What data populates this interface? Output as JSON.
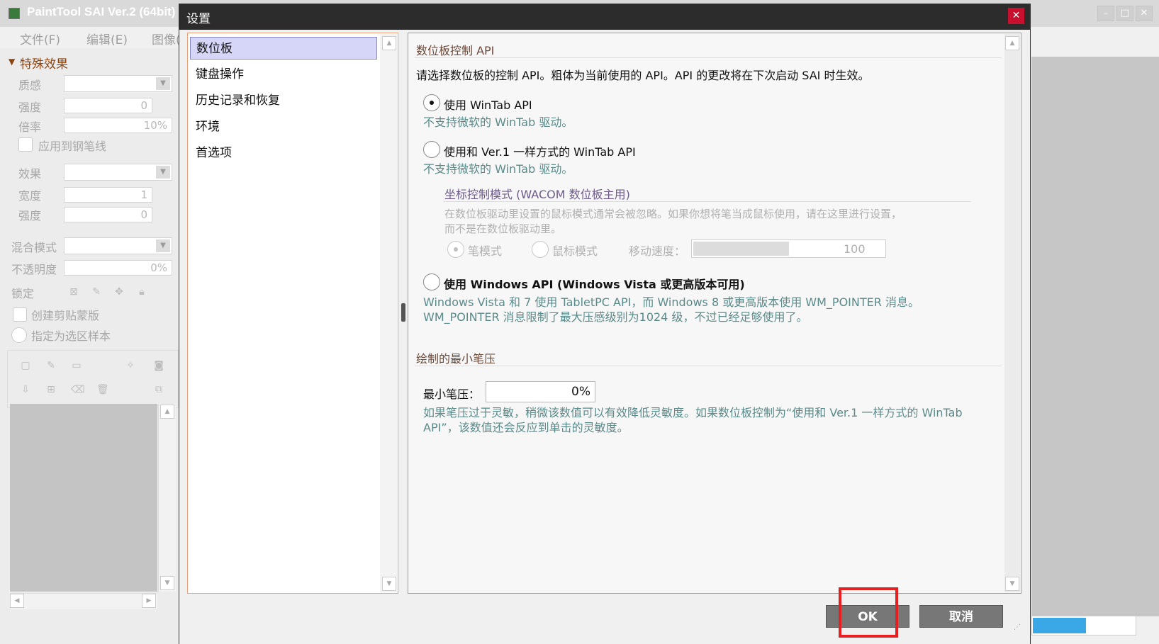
{
  "background_app": {
    "title": "PaintTool SAI Ver.2 (64bit)",
    "menu": [
      "文件(F)",
      "编辑(E)",
      "图像("
    ],
    "left_panel": {
      "section_title": "特殊效果",
      "texture_label": "质感",
      "strength_label": "强度",
      "strength_value": "0",
      "scale_label": "倍率",
      "scale_value": "10%",
      "apply_pen_label": "应用到钢笔线",
      "effect_label": "效果",
      "width_label": "宽度",
      "width_value": "1",
      "strength2_label": "强度",
      "strength2_value": "0",
      "blend_mode_label": "混合模式",
      "opacity_label": "不透明度",
      "opacity_value": "0%",
      "lock_label": "锁定",
      "clip_label": "创建剪贴蒙版",
      "selection_sample_label": "指定为选区样本"
    }
  },
  "dialog": {
    "title": "设置",
    "nav_items": [
      "数位板",
      "键盘操作",
      "历史记录和恢复",
      "环境",
      "首选项"
    ],
    "selected_nav": "数位板",
    "tablet_api": {
      "section_title": "数位板控制 API",
      "description": "请选择数位板的控制 API。粗体为当前使用的 API。API 的更改将在下次启动 SAI 时生效。",
      "options": [
        {
          "label": "使用 WinTab API",
          "note": "不支持微软的 WinTab 驱动。",
          "checked": true,
          "bold": false
        },
        {
          "label": "使用和 Ver.1 一样方式的 WinTab API",
          "note": "不支持微软的 WinTab 驱动。",
          "checked": false,
          "bold": false
        },
        {
          "label": "使用 Windows API (Windows Vista 或更高版本可用)",
          "note_lines": [
            "Windows Vista 和 7 使用 TabletPC API，而 Windows 8 或更高版本使用 WM_POINTER 消息。",
            "WM_POINTER 消息限制了最大压感级别为1024 级，不过已经足够使用了。"
          ],
          "checked": false,
          "bold": true
        }
      ],
      "coord_mode": {
        "title": "坐标控制模式 (WACOM 数位板主用)",
        "desc_lines": [
          "在数位板驱动里设置的鼠标模式通常会被忽略。如果你想将笔当成鼠标使用，请在这里进行设置，",
          "而不是在数位板驱动里。"
        ],
        "pen_mode": "笔模式",
        "mouse_mode": "鼠标模式",
        "speed_label": "移动速度：",
        "speed_value": "100",
        "speed_fraction": 0.5
      }
    },
    "min_pressure": {
      "section_title": "绘制的最小笔压",
      "label": "最小笔压：",
      "value": "0%",
      "hint_lines": [
        "如果笔压过于灵敏，稍微该数值可以有效降低灵敏度。如果数位板控制为“使用和 Ver.1 一样方式的 WinTab",
        "API”，该数值还会反应到单击的灵敏度。"
      ]
    },
    "ok_label": "OK",
    "cancel_label": "取消"
  },
  "colors": {
    "dialog_title_bar": "#2c2c2c",
    "close_button": "#c8102e",
    "nav_selected": "#d6d6f8",
    "section_title": "#6d4a3a",
    "hint_text": "#5a8a8a",
    "highlight_box": "#e62020",
    "progress_fill": "#3aa8e6"
  }
}
